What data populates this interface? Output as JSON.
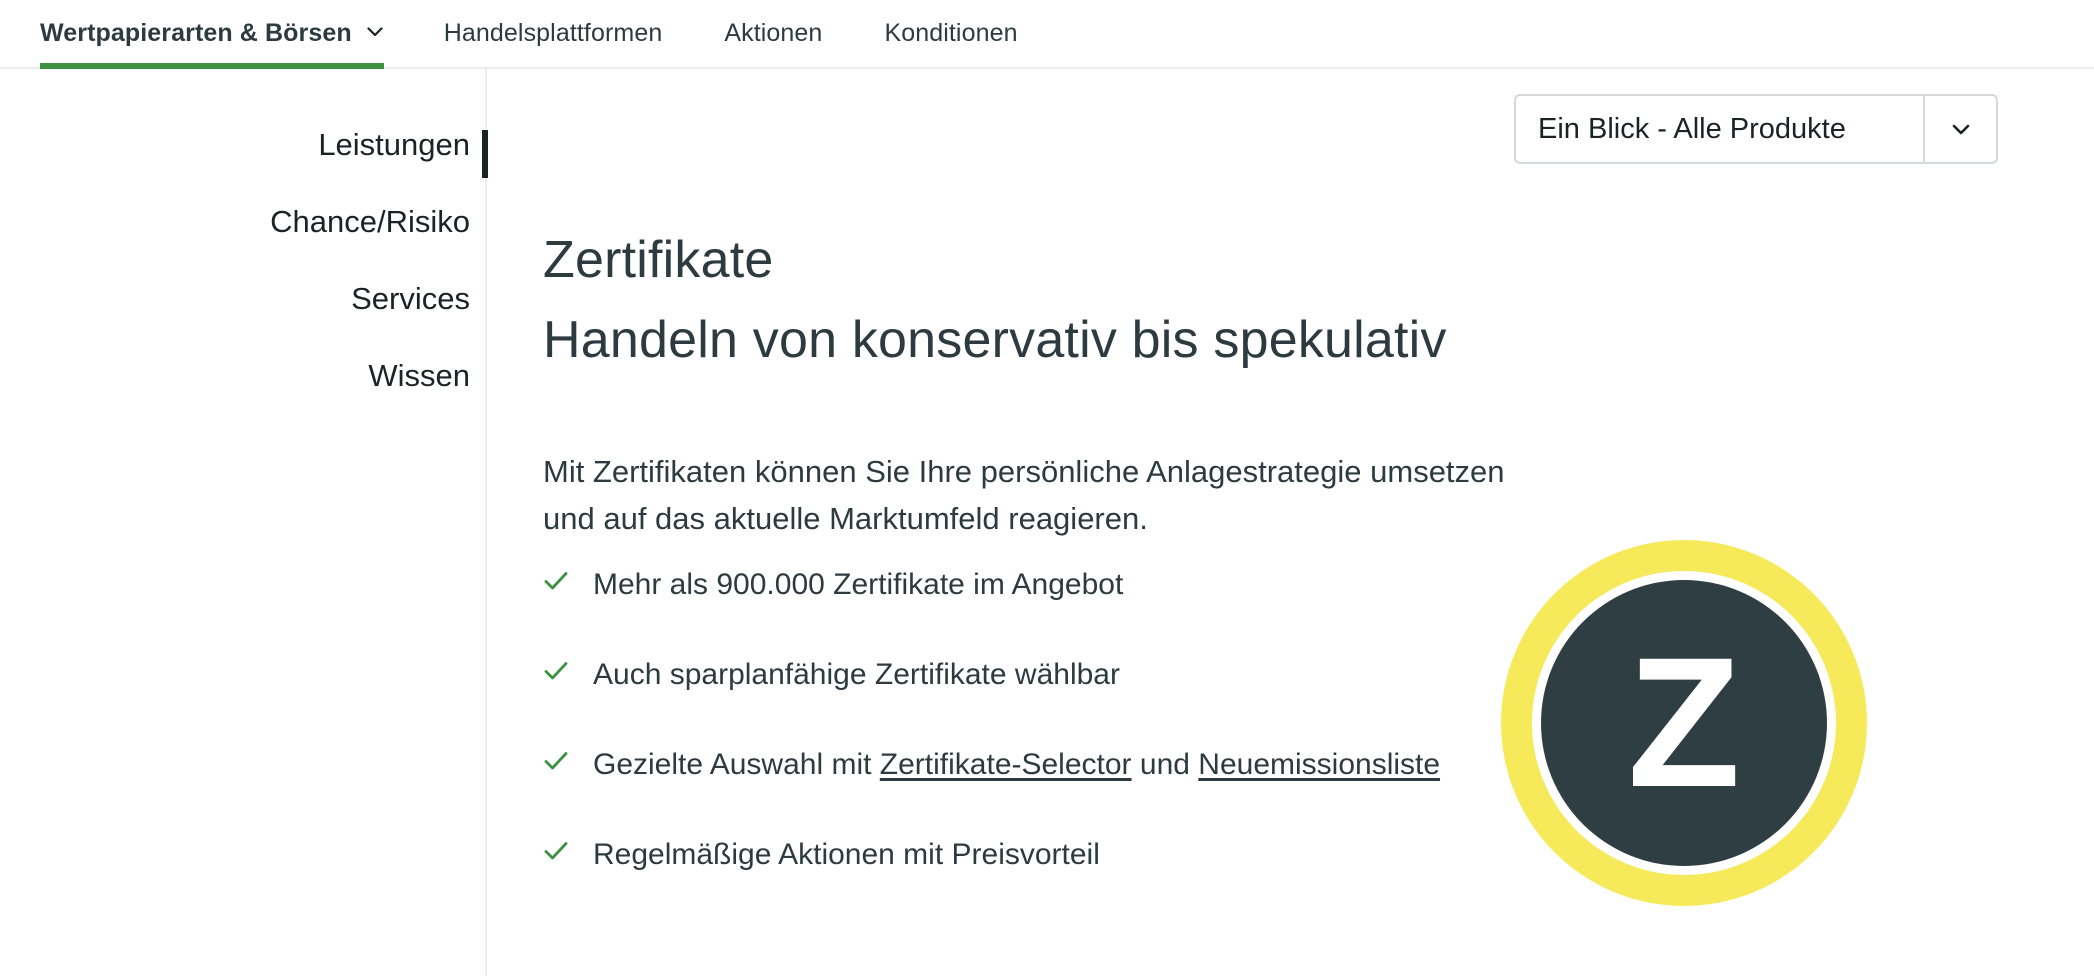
{
  "topnav": {
    "items": [
      {
        "label": "Wertpapierarten & Börsen",
        "active": true,
        "has_chevron": true
      },
      {
        "label": "Handelsplattformen",
        "active": false,
        "has_chevron": false
      },
      {
        "label": "Aktionen",
        "active": false,
        "has_chevron": false
      },
      {
        "label": "Konditionen",
        "active": false,
        "has_chevron": false
      }
    ],
    "active_underline_color": "#3f9142"
  },
  "sidebar": {
    "items": [
      {
        "label": "Leistungen",
        "active": true
      },
      {
        "label": "Chance/Risiko",
        "active": false
      },
      {
        "label": "Services",
        "active": false
      },
      {
        "label": "Wissen",
        "active": false
      }
    ],
    "active_marker_color": "#1a2326"
  },
  "dropdown": {
    "selected": "Ein Blick - Alle Produkte",
    "icon": "chevron-down-icon"
  },
  "main": {
    "title": "Zertifikate",
    "subtitle": "Handeln von konservativ bis spekulativ",
    "lede": "Mit Zertifikaten können Sie Ihre persönliche Anlagestrategie umsetzen und auf das aktuelle Marktumfeld reagieren.",
    "benefits": [
      {
        "id": "benefit-count",
        "prefix": "Mehr als 900.000 Zertifikate im Angebot",
        "link1": "",
        "middle": "",
        "link2": "",
        "suffix": ""
      },
      {
        "id": "benefit-sparplan",
        "prefix": "Auch sparplanfähige Zertifikate wählbar",
        "link1": "",
        "middle": "",
        "link2": "",
        "suffix": ""
      },
      {
        "id": "benefit-selector",
        "prefix": "Gezielte Auswahl mit ",
        "link1": "Zertifikate-Selector",
        "middle": " und ",
        "link2": "Neuemissionsliste",
        "suffix": ""
      },
      {
        "id": "benefit-aktionen",
        "prefix": "Regelmäßige Aktionen mit Preisvorteil",
        "link1": "",
        "middle": "",
        "link2": "",
        "suffix": ""
      }
    ],
    "check_color": "#3f9142"
  },
  "logo": {
    "letter": "Z",
    "ring_color": "#f7ea5a",
    "disc_color": "#2f3e43",
    "letter_color": "#ffffff"
  }
}
